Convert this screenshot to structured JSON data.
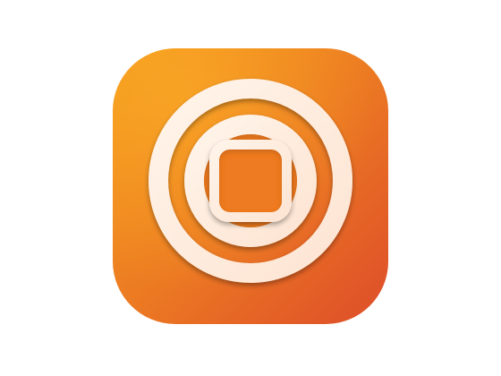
{
  "colors": {
    "background": "#ffffff",
    "tile_gradient_top_left": "#f39a1c",
    "tile_gradient_mid": "#ec7a22",
    "tile_gradient_bottom_right": "#de4d2a",
    "ring_fill": "#fde4d2",
    "ring_highlight": "#fff4ea",
    "inner_fill": "#ee7a23"
  },
  "icon": {
    "name": "record-stop-icon"
  }
}
